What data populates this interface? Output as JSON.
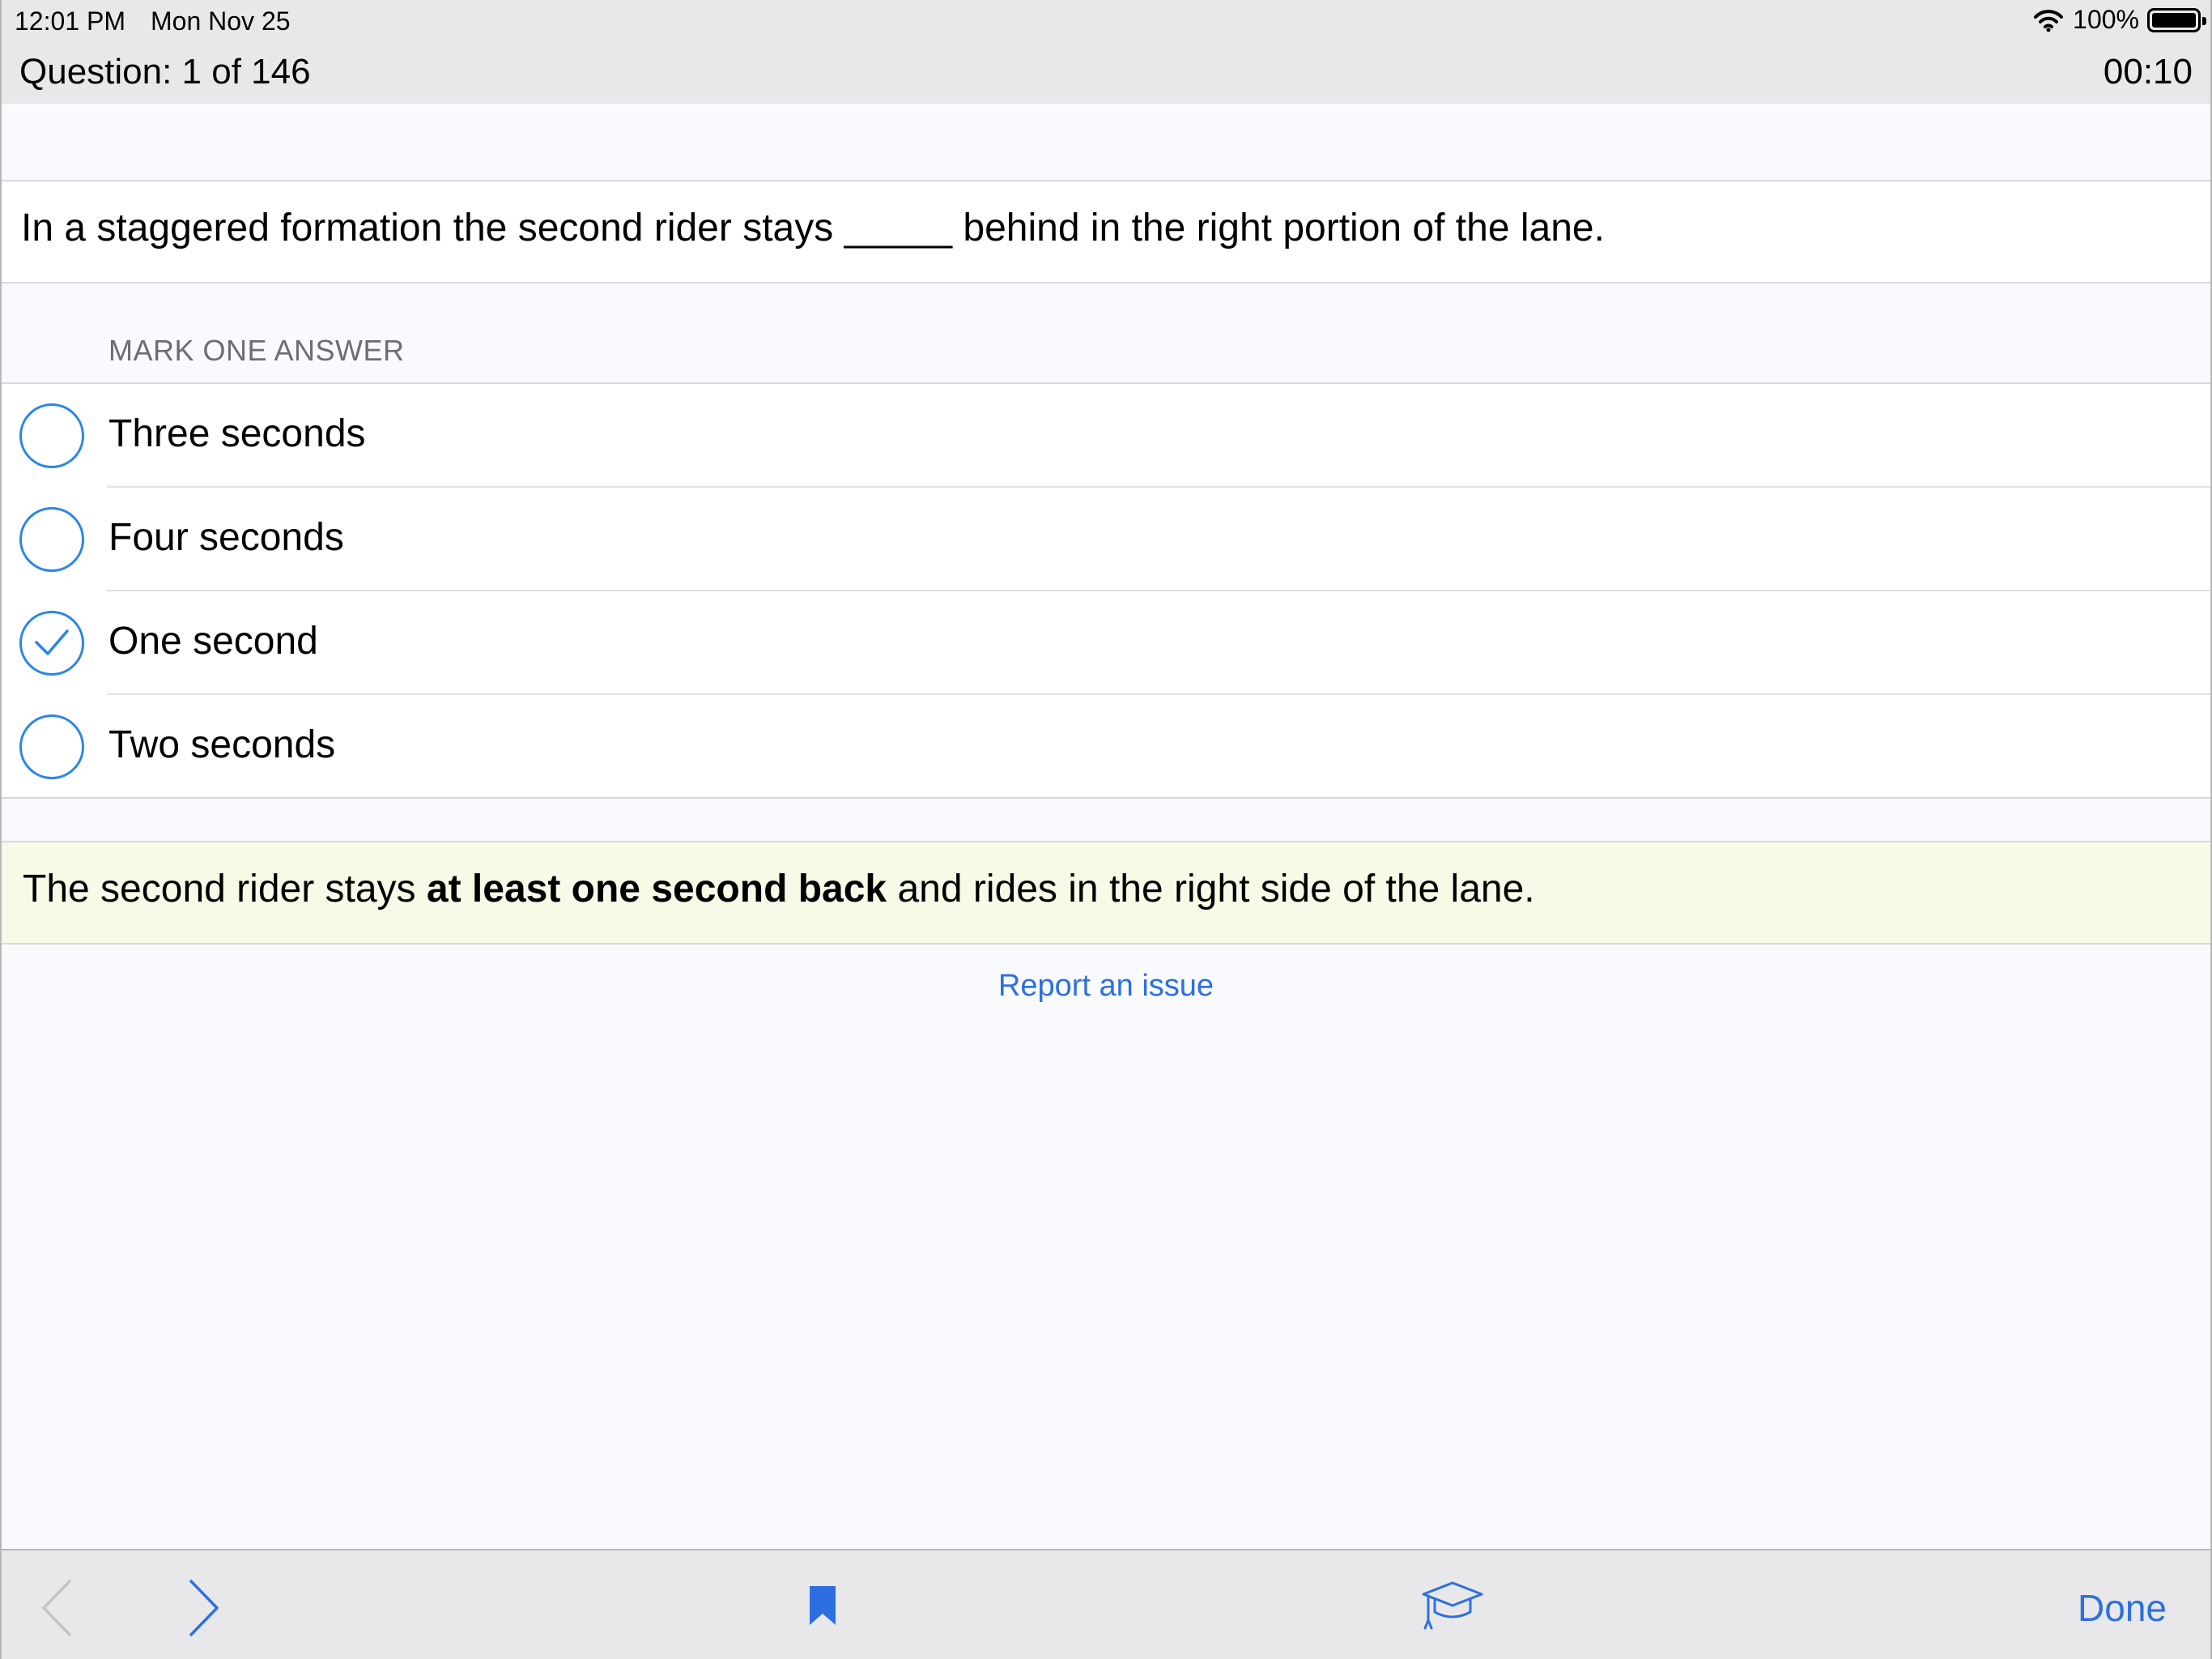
{
  "status_bar": {
    "time": "12:01 PM",
    "date": "Mon Nov 25",
    "battery": "100%"
  },
  "header": {
    "question_counter": "Question: 1 of 146",
    "timer": "00:10"
  },
  "question": {
    "text_before": "In a staggered formation the second rider stays",
    "blank": "_____",
    "text_after": "behind in the right portion of the lane."
  },
  "answers_header": "MARK ONE ANSWER",
  "answers": [
    {
      "label": "Three seconds",
      "selected": false
    },
    {
      "label": "Four seconds",
      "selected": false
    },
    {
      "label": "One second",
      "selected": true
    },
    {
      "label": "Two seconds",
      "selected": false
    }
  ],
  "explanation": {
    "before": "The second rider stays",
    "bold": "at least one second back",
    "after": "and rides in the right side of the lane."
  },
  "report_link": "Report an issue",
  "toolbar": {
    "back_icon": "chevron-left-icon",
    "forward_icon": "chevron-right-icon",
    "bookmark_icon": "bookmark-icon",
    "study_icon": "graduation-cap-icon",
    "done_label": "Done"
  },
  "colors": {
    "accent": "#2d6fe0",
    "radio": "#2a86e8",
    "explanation_bg": "#f8fae8",
    "header_bg": "#e8e8ea"
  }
}
